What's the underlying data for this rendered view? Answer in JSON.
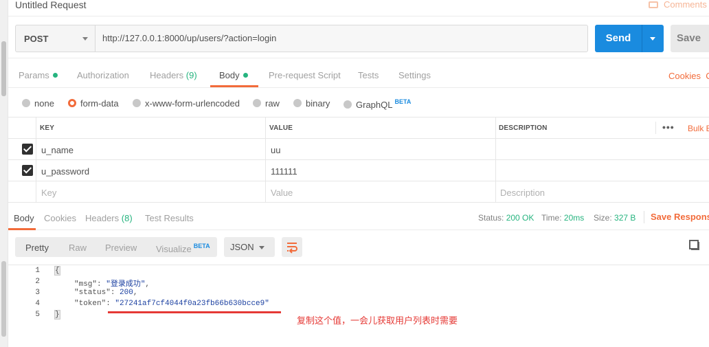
{
  "window": {
    "title": "Untitled Request",
    "comments_label": "Comments"
  },
  "request": {
    "method": "POST",
    "url": "http://127.0.0.1:8000/up/users/?action=login",
    "send_label": "Send",
    "save_label": "Save"
  },
  "req_tabs": {
    "params": "Params",
    "authorization": "Authorization",
    "headers": "Headers",
    "headers_count": "(9)",
    "body": "Body",
    "prerequest": "Pre-request Script",
    "tests": "Tests",
    "settings": "Settings",
    "cookies": "Cookies",
    "code": "C"
  },
  "body_types": {
    "none": "none",
    "form_data": "form-data",
    "urlencoded": "x-www-form-urlencoded",
    "raw": "raw",
    "binary": "binary",
    "graphql": "GraphQL",
    "beta": "BETA",
    "selected": "form-data"
  },
  "kv_table": {
    "headers": {
      "key": "KEY",
      "value": "VALUE",
      "description": "DESCRIPTION"
    },
    "bulk_edit": "Bulk E",
    "more": "•••",
    "rows": [
      {
        "checked": true,
        "key": "u_name",
        "value": "uu",
        "description": ""
      },
      {
        "checked": true,
        "key": "u_password",
        "value": "111111",
        "description": ""
      }
    ],
    "placeholders": {
      "key": "Key",
      "value": "Value",
      "description": "Description"
    }
  },
  "resp_tabs": {
    "body": "Body",
    "cookies": "Cookies",
    "headers": "Headers",
    "headers_count": "(8)",
    "test_results": "Test Results"
  },
  "resp_status": {
    "status_label": "Status:",
    "status_value": "200 OK",
    "time_label": "Time:",
    "time_value": "20ms",
    "size_label": "Size:",
    "size_value": "327 B",
    "save_response": "Save Response"
  },
  "view_modes": {
    "pretty": "Pretty",
    "raw": "Raw",
    "preview": "Preview",
    "visualize": "Visualize",
    "beta": "BETA",
    "format": "JSON"
  },
  "response_lines": [
    {
      "n": "1",
      "text": "{"
    },
    {
      "n": "2",
      "key": "\"msg\"",
      "val": "\"登录成功\"",
      "trail": ","
    },
    {
      "n": "3",
      "key": "\"status\"",
      "val": "200",
      "trail": ","
    },
    {
      "n": "4",
      "key": "\"token\"",
      "val": "\"27241af7cf4044f0a23fb66b630bcce9\"",
      "trail": ""
    },
    {
      "n": "5",
      "text": "}"
    }
  ],
  "annotation": "复制这个值，一会儿获取用户列表时需要",
  "colors": {
    "accent": "#f26b3a",
    "send": "#1a8bdf",
    "success": "#26b47f",
    "annotation": "#e53935"
  }
}
